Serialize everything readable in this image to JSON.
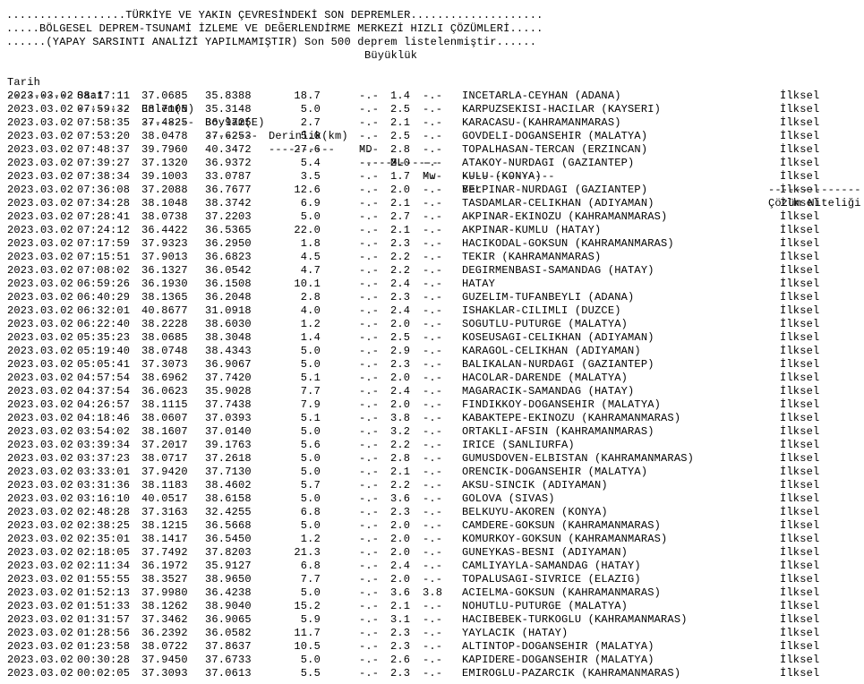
{
  "banner": [
    "..................TÜRKİYE VE YAKIN ÇEVRESİNDEKİ SON DEPREMLER....................",
    ".....BÖLGESEL DEPREM-TSUNAMİ İZLEME VE DEĞERLENDİRME MERKEZİ HIZLI ÇÖZÜMLERİ.....",
    "......(YAPAY SARSINTI ANALİZİ YAPILMAMIŞTIR) Son 500 deprem listelenmiştir......"
  ],
  "buyukluk_label": "Büyüklük",
  "headers": {
    "date": "Tarih",
    "time": "Saat",
    "lat": "Enlem(N)",
    "lon": "Boylam(E)",
    "depth": "Derinlik(km)",
    "md": "MD",
    "ml": "ML",
    "mw": "Mw",
    "loc": "Yer",
    "quality": "Çözüm Niteliği"
  },
  "dashes": {
    "date": "----------",
    "time": "--------",
    "lat": "--------",
    "lon": "--------",
    "depth": "----------",
    "mag": "------------",
    "loc": "--------------",
    "quality": "--------------"
  },
  "rows": [
    [
      "2023.03.02",
      "08:17:11",
      "37.0685",
      "35.8388",
      "18.7",
      "-.-",
      "1.4",
      "-.-",
      "INCETARLA-CEYHAN (ADANA)",
      "İlksel"
    ],
    [
      "2023.03.02",
      "07:59:32",
      "38.7105",
      "35.3148",
      "5.0",
      "-.-",
      "2.5",
      "-.-",
      "KARPUZSEKISI-HACILAR (KAYSERI)",
      "İlksel"
    ],
    [
      "2023.03.02",
      "07:58:35",
      "37.4825",
      "36.9725",
      "2.7",
      "-.-",
      "2.1",
      "-.-",
      "KARACASU-(KAHRAMANMARAS)",
      "İlksel"
    ],
    [
      "2023.03.02",
      "07:53:20",
      "38.0478",
      "37.6253",
      "5.0",
      "-.-",
      "2.5",
      "-.-",
      "GOVDELI-DOGANSEHIR (MALATYA)",
      "İlksel"
    ],
    [
      "2023.03.02",
      "07:48:37",
      "39.7960",
      "40.3472",
      "27.6",
      "-.-",
      "2.8",
      "-.-",
      "TOPALHASAN-TERCAN (ERZINCAN)",
      "İlksel"
    ],
    [
      "2023.03.02",
      "07:39:27",
      "37.1320",
      "36.9372",
      "5.4",
      "-.-",
      "2.0",
      "-.-",
      "ATAKOY-NURDAGI (GAZIANTEP)",
      "İlksel"
    ],
    [
      "2023.03.02",
      "07:38:34",
      "39.1003",
      "33.0787",
      "3.5",
      "-.-",
      "1.7",
      "-.-",
      "KULU (KONYA)",
      "İlksel"
    ],
    [
      "2023.03.02",
      "07:36:08",
      "37.2088",
      "36.7677",
      "12.6",
      "-.-",
      "2.0",
      "-.-",
      "BELPINAR-NURDAGI (GAZIANTEP)",
      "İlksel"
    ],
    [
      "2023.03.02",
      "07:34:28",
      "38.1048",
      "38.3742",
      "6.9",
      "-.-",
      "2.1",
      "-.-",
      "TASDAMLAR-CELIKHAN (ADIYAMAN)",
      "İlksel"
    ],
    [
      "2023.03.02",
      "07:28:41",
      "38.0738",
      "37.2203",
      "5.0",
      "-.-",
      "2.7",
      "-.-",
      "AKPINAR-EKINOZU (KAHRAMANMARAS)",
      "İlksel"
    ],
    [
      "2023.03.02",
      "07:24:12",
      "36.4422",
      "36.5365",
      "22.0",
      "-.-",
      "2.1",
      "-.-",
      "AKPINAR-KUMLU (HATAY)",
      "İlksel"
    ],
    [
      "2023.03.02",
      "07:17:59",
      "37.9323",
      "36.2950",
      "1.8",
      "-.-",
      "2.3",
      "-.-",
      "HACIKODAL-GOKSUN (KAHRAMANMARAS)",
      "İlksel"
    ],
    [
      "2023.03.02",
      "07:15:51",
      "37.9013",
      "36.6823",
      "4.5",
      "-.-",
      "2.2",
      "-.-",
      "TEKIR (KAHRAMANMARAS)",
      "İlksel"
    ],
    [
      "2023.03.02",
      "07:08:02",
      "36.1327",
      "36.0542",
      "4.7",
      "-.-",
      "2.2",
      "-.-",
      "DEGIRMENBASI-SAMANDAG (HATAY)",
      "İlksel"
    ],
    [
      "2023.03.02",
      "06:59:26",
      "36.1930",
      "36.1508",
      "10.1",
      "-.-",
      "2.4",
      "-.-",
      "HATAY",
      "İlksel"
    ],
    [
      "2023.03.02",
      "06:40:29",
      "38.1365",
      "36.2048",
      "2.8",
      "-.-",
      "2.3",
      "-.-",
      "GUZELIM-TUFANBEYLI (ADANA)",
      "İlksel"
    ],
    [
      "2023.03.02",
      "06:32:01",
      "40.8677",
      "31.0918",
      "4.0",
      "-.-",
      "2.4",
      "-.-",
      "ISHAKLAR-CILIMLI (DUZCE)",
      "İlksel"
    ],
    [
      "2023.03.02",
      "06:22:40",
      "38.2228",
      "38.6030",
      "1.2",
      "-.-",
      "2.0",
      "-.-",
      "SOGUTLU-PUTURGE (MALATYA)",
      "İlksel"
    ],
    [
      "2023.03.02",
      "05:35:23",
      "38.0685",
      "38.3048",
      "1.4",
      "-.-",
      "2.5",
      "-.-",
      "KOSEUSAGI-CELIKHAN (ADIYAMAN)",
      "İlksel"
    ],
    [
      "2023.03.02",
      "05:19:40",
      "38.0748",
      "38.4343",
      "5.0",
      "-.-",
      "2.9",
      "-.-",
      "KARAGOL-CELIKHAN (ADIYAMAN)",
      "İlksel"
    ],
    [
      "2023.03.02",
      "05:05:41",
      "37.3073",
      "36.9067",
      "5.0",
      "-.-",
      "2.3",
      "-.-",
      "BALIKALAN-NURDAGI (GAZIANTEP)",
      "İlksel"
    ],
    [
      "2023.03.02",
      "04:57:54",
      "38.6962",
      "37.7420",
      "5.1",
      "-.-",
      "2.0",
      "-.-",
      "HACOLAR-DARENDE (MALATYA)",
      "İlksel"
    ],
    [
      "2023.03.02",
      "04:37:54",
      "36.0623",
      "35.9028",
      "7.7",
      "-.-",
      "2.4",
      "-.-",
      "MAGARACIK-SAMANDAG (HATAY)",
      "İlksel"
    ],
    [
      "2023.03.02",
      "04:26:57",
      "38.1115",
      "37.7438",
      "7.9",
      "-.-",
      "2.0",
      "-.-",
      "FINDIKKOY-DOGANSEHIR (MALATYA)",
      "İlksel"
    ],
    [
      "2023.03.02",
      "04:18:46",
      "38.0607",
      "37.0393",
      "5.1",
      "-.-",
      "3.8",
      "-.-",
      "KABAKTEPE-EKINOZU (KAHRAMANMARAS)",
      "İlksel"
    ],
    [
      "2023.03.02",
      "03:54:02",
      "38.1607",
      "37.0140",
      "5.0",
      "-.-",
      "3.2",
      "-.-",
      "ORTAKLI-AFSIN (KAHRAMANMARAS)",
      "İlksel"
    ],
    [
      "2023.03.02",
      "03:39:34",
      "37.2017",
      "39.1763",
      "5.6",
      "-.-",
      "2.2",
      "-.-",
      "IRICE (SANLIURFA)",
      "İlksel"
    ],
    [
      "2023.03.02",
      "03:37:23",
      "38.0717",
      "37.2618",
      "5.0",
      "-.-",
      "2.8",
      "-.-",
      "GUMUSDOVEN-ELBISTAN (KAHRAMANMARAS)",
      "İlksel"
    ],
    [
      "2023.03.02",
      "03:33:01",
      "37.9420",
      "37.7130",
      "5.0",
      "-.-",
      "2.1",
      "-.-",
      "ORENCIK-DOGANSEHIR (MALATYA)",
      "İlksel"
    ],
    [
      "2023.03.02",
      "03:31:36",
      "38.1183",
      "38.4602",
      "5.7",
      "-.-",
      "2.2",
      "-.-",
      "AKSU-SINCIK (ADIYAMAN)",
      "İlksel"
    ],
    [
      "2023.03.02",
      "03:16:10",
      "40.0517",
      "38.6158",
      "5.0",
      "-.-",
      "3.6",
      "-.-",
      "GOLOVA (SIVAS)",
      "İlksel"
    ],
    [
      "2023.03.02",
      "02:48:28",
      "37.3163",
      "32.4255",
      "6.8",
      "-.-",
      "2.3",
      "-.-",
      "BELKUYU-AKOREN (KONYA)",
      "İlksel"
    ],
    [
      "2023.03.02",
      "02:38:25",
      "38.1215",
      "36.5668",
      "5.0",
      "-.-",
      "2.0",
      "-.-",
      "CAMDERE-GOKSUN (KAHRAMANMARAS)",
      "İlksel"
    ],
    [
      "2023.03.02",
      "02:35:01",
      "38.1417",
      "36.5450",
      "1.2",
      "-.-",
      "2.0",
      "-.-",
      "KOMURKOY-GOKSUN (KAHRAMANMARAS)",
      "İlksel"
    ],
    [
      "2023.03.02",
      "02:18:05",
      "37.7492",
      "37.8203",
      "21.3",
      "-.-",
      "2.0",
      "-.-",
      "GUNEYKAS-BESNI (ADIYAMAN)",
      "İlksel"
    ],
    [
      "2023.03.02",
      "02:11:34",
      "36.1972",
      "35.9127",
      "6.8",
      "-.-",
      "2.4",
      "-.-",
      "CAMLIYAYLA-SAMANDAG (HATAY)",
      "İlksel"
    ],
    [
      "2023.03.02",
      "01:55:55",
      "38.3527",
      "38.9650",
      "7.7",
      "-.-",
      "2.0",
      "-.-",
      "TOPALUSAGI-SIVRICE (ELAZIG)",
      "İlksel"
    ],
    [
      "2023.03.02",
      "01:52:13",
      "37.9980",
      "36.4238",
      "5.0",
      "-.-",
      "3.6",
      "3.8",
      "ACIELMA-GOKSUN (KAHRAMANMARAS)",
      "İlksel"
    ],
    [
      "2023.03.02",
      "01:51:33",
      "38.1262",
      "38.9040",
      "15.2",
      "-.-",
      "2.1",
      "-.-",
      "NOHUTLU-PUTURGE (MALATYA)",
      "İlksel"
    ],
    [
      "2023.03.02",
      "01:31:57",
      "37.3462",
      "36.9065",
      "5.9",
      "-.-",
      "3.1",
      "-.-",
      "HACIBEBEK-TURKOGLU (KAHRAMANMARAS)",
      "İlksel"
    ],
    [
      "2023.03.02",
      "01:28:56",
      "36.2392",
      "36.0582",
      "11.7",
      "-.-",
      "2.3",
      "-.-",
      "YAYLACIK (HATAY)",
      "İlksel"
    ],
    [
      "2023.03.02",
      "01:23:58",
      "38.0722",
      "37.8637",
      "10.5",
      "-.-",
      "2.3",
      "-.-",
      "ALTINTOP-DOGANSEHIR (MALATYA)",
      "İlksel"
    ],
    [
      "2023.03.02",
      "00:30:28",
      "37.9450",
      "37.6733",
      "5.0",
      "-.-",
      "2.6",
      "-.-",
      "KAPIDERE-DOGANSEHIR (MALATYA)",
      "İlksel"
    ],
    [
      "2023.03.02",
      "00:02:05",
      "37.3093",
      "37.0613",
      "5.5",
      "-.-",
      "2.3",
      "-.-",
      "EMIROGLU-PAZARCIK (KAHRAMANMARAS)",
      "İlksel"
    ]
  ]
}
